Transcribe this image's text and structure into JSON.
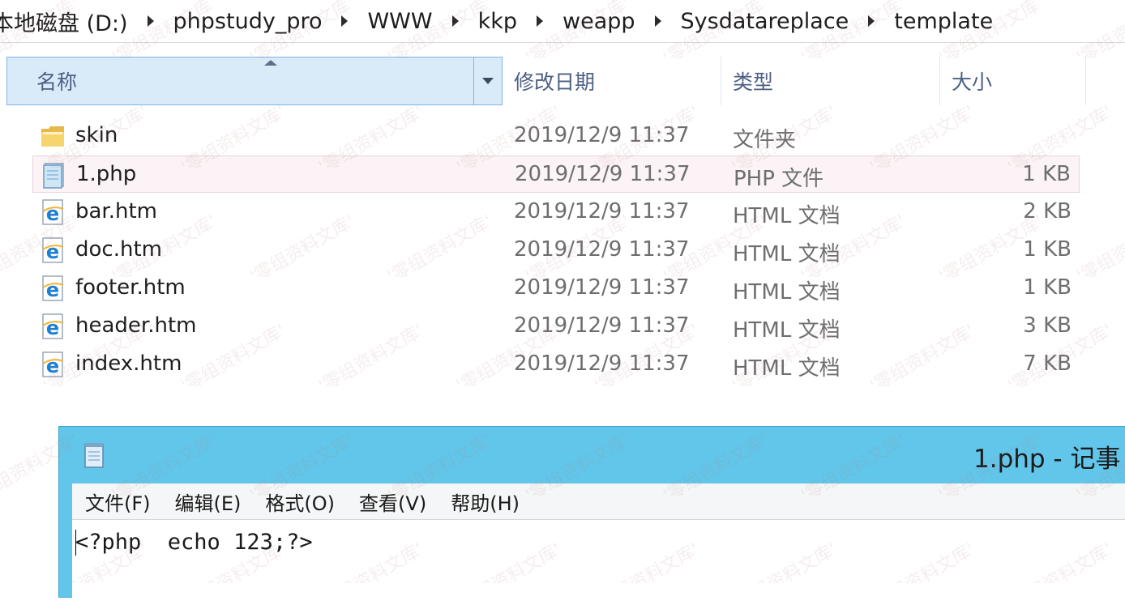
{
  "breadcrumb": [
    "本地磁盘 (D:)",
    "phpstudy_pro",
    "WWW",
    "kkp",
    "weapp",
    "Sysdatareplace",
    "template"
  ],
  "columns": {
    "name": "名称",
    "date": "修改日期",
    "type": "类型",
    "size": "大小"
  },
  "files": [
    {
      "name": "skin",
      "date": "2019/12/9 11:37",
      "type": "文件夹",
      "size": "",
      "icon": "folder-icon"
    },
    {
      "name": "1.php",
      "date": "2019/12/9 11:37",
      "type": "PHP 文件",
      "size": "1 KB",
      "icon": "php-file-icon",
      "selected": true
    },
    {
      "name": "bar.htm",
      "date": "2019/12/9 11:37",
      "type": "HTML 文档",
      "size": "2 KB",
      "icon": "html-file-icon"
    },
    {
      "name": "doc.htm",
      "date": "2019/12/9 11:37",
      "type": "HTML 文档",
      "size": "1 KB",
      "icon": "html-file-icon"
    },
    {
      "name": "footer.htm",
      "date": "2019/12/9 11:37",
      "type": "HTML 文档",
      "size": "1 KB",
      "icon": "html-file-icon"
    },
    {
      "name": "header.htm",
      "date": "2019/12/9 11:37",
      "type": "HTML 文档",
      "size": "3 KB",
      "icon": "html-file-icon"
    },
    {
      "name": "index.htm",
      "date": "2019/12/9 11:37",
      "type": "HTML 文档",
      "size": "7 KB",
      "icon": "html-file-icon"
    }
  ],
  "notepad": {
    "title": "1.php - 记事",
    "menu": [
      "文件(F)",
      "编辑(E)",
      "格式(O)",
      "查看(V)",
      "帮助(H)"
    ],
    "content": "<?php  echo 123;?>"
  },
  "watermark": "'零组资料文库'",
  "colors": {
    "header_selected": "#d9ebf9",
    "notepad_titlebar": "#62c6ea",
    "row_selected": "#fbf3f5"
  }
}
